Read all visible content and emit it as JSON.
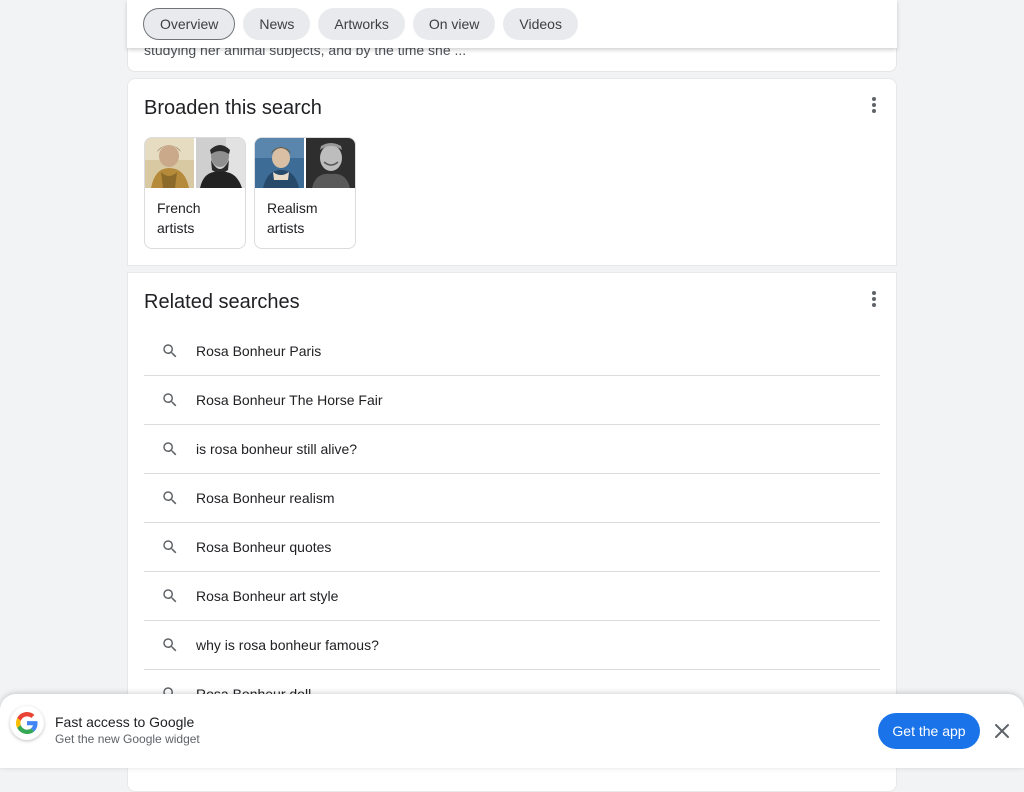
{
  "snippet": {
    "text": "studying her animal subjects, and by the time she ..."
  },
  "tabs": [
    {
      "label": "Overview",
      "active": true
    },
    {
      "label": "News"
    },
    {
      "label": "Artworks"
    },
    {
      "label": "On view"
    },
    {
      "label": "Videos"
    }
  ],
  "broaden": {
    "title": "Broaden this search",
    "items": [
      {
        "label": "French artists"
      },
      {
        "label": "Realism artists"
      }
    ]
  },
  "related": {
    "title": "Related searches",
    "items": [
      "Rosa Bonheur Paris",
      "Rosa Bonheur The Horse Fair",
      "is rosa bonheur still alive?",
      "Rosa Bonheur realism",
      "Rosa Bonheur quotes",
      "Rosa Bonheur art style",
      "why is rosa bonheur famous?",
      "Rosa Bonheur doll"
    ]
  },
  "banner": {
    "title": "Fast access to Google",
    "subtitle": "Get the new Google widget",
    "cta": "Get the app",
    "accent": "#1a73e8"
  }
}
